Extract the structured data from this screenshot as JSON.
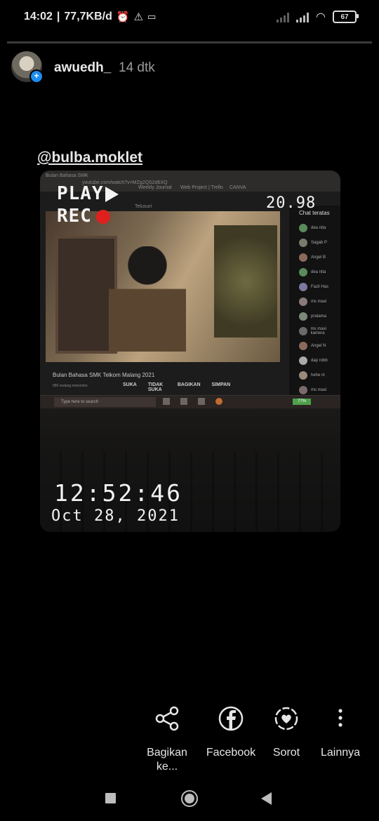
{
  "status_bar": {
    "time": "14:02",
    "speed": "77,7KB/d",
    "battery": "67"
  },
  "story": {
    "progress": 0.0,
    "username": "awuedh_",
    "time_ago": "14 dtk",
    "mention": "@bulba.moklet"
  },
  "photo": {
    "overlay_play": "PLAY",
    "overlay_rec": "REC",
    "counter": "20.98",
    "clock": "12:52:46",
    "date": "Oct 28, 2021",
    "browser": {
      "tab": "Bulan Bahasa SMK",
      "url": "youtube.com/watch?v=MZg2QS2d6XQ",
      "bookmark1": "Weekly Journal",
      "bookmark2": "Web Project | Trello",
      "bookmark3": "CANVA",
      "search_hint": "Telusuri"
    },
    "video": {
      "title": "Bulan Bahasa SMK Telkom Malang 2021",
      "views": "580 sedang menonton",
      "like": "SUKA",
      "dislike": "TIDAK SUKA",
      "share": "BAGIKAN",
      "save": "SIMPAN"
    },
    "chat": {
      "header": "Chat teratas",
      "rows": [
        "dea nita",
        "Sagab P",
        "Angel B",
        "dea nita",
        "Fazil Has",
        "ms maxi",
        "pratama",
        "ms maxi kamera",
        "Angel N",
        "dap robb",
        "hehe ni",
        "ms maxi"
      ]
    },
    "taskbar": {
      "search": "Type here to search",
      "battery": "77%"
    }
  },
  "actions": [
    {
      "label": "Bagikan\nke...",
      "icon": "share-icon"
    },
    {
      "label": "Facebook",
      "icon": "facebook-icon"
    },
    {
      "label": "Sorot",
      "icon": "highlight-icon"
    },
    {
      "label": "Lainnya",
      "icon": "more-vertical-icon"
    }
  ],
  "nav": {
    "recents_icon": "square-icon",
    "home_icon": "circle-icon",
    "back_icon": "triangle-back-icon"
  }
}
